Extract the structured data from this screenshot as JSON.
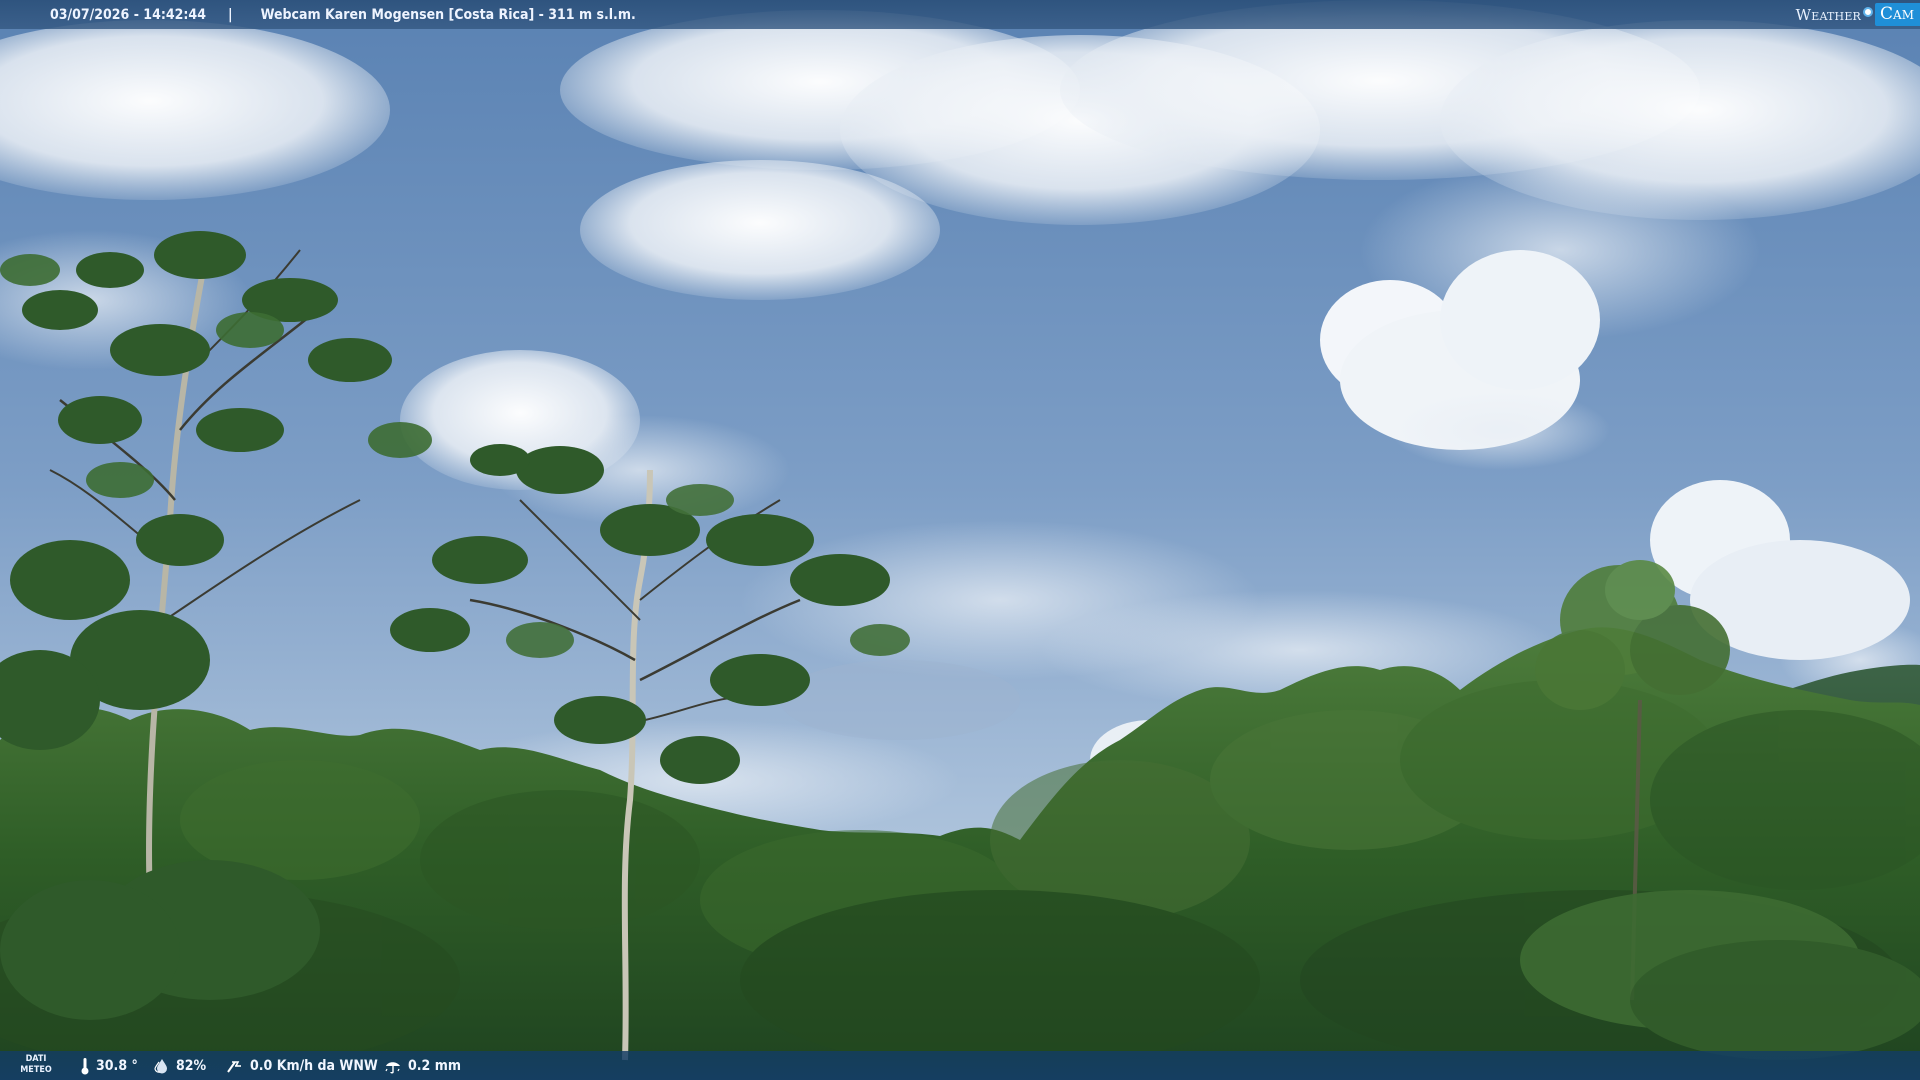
{
  "header": {
    "datetime": "03/07/2026 - 14:42:44",
    "separator": "|",
    "camera_title": "Webcam Karen Mogensen [Costa Rica] - 311 m s.l.m.",
    "brand_weather": "Weather",
    "brand_cam": "Cam"
  },
  "footer": {
    "label_line1": "DATI",
    "label_line2": "METEO",
    "temperature": "30.8 °",
    "humidity": "82%",
    "wind": "0.0 Km/h da WNW",
    "rain": "0.2 mm"
  },
  "icons": {
    "temperature": "thermometer-icon",
    "humidity": "humidity-drop-icon",
    "wind": "wind-icon",
    "rain": "rain-icon"
  },
  "colors": {
    "bar": "#2b507a",
    "brand_accent": "#1f8fd8",
    "sky": "#6b90bd",
    "foliage": "#2f5e27"
  }
}
